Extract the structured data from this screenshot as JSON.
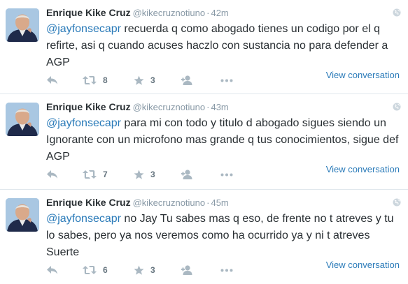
{
  "colors": {
    "link": "#2b7bb9",
    "muted": "#8899a6",
    "text": "#292f33",
    "icon": "#aab8c2"
  },
  "tweets": [
    {
      "author_name": "Enrique Kike Cruz",
      "handle": "@kikecruznotiuno",
      "separator": "·",
      "time": "42m",
      "mention": "@jayfonsecapr",
      "body": " recuerda q como abogado tienes un codigo por el q refirte, asi q cuando acuses haczlo con sustancia no para defender a AGP",
      "view_conversation": "View conversation",
      "retweet_count": "8",
      "favorite_count": "3"
    },
    {
      "author_name": "Enrique Kike Cruz",
      "handle": "@kikecruznotiuno",
      "separator": "·",
      "time": "43m",
      "mention": "@jayfonsecapr",
      "body": " para mi con todo y titulo d abogado sigues siendo un Ignorante con un microfono mas grande q tus conocimientos, sigue def AGP",
      "view_conversation": "View conversation",
      "retweet_count": "7",
      "favorite_count": "3"
    },
    {
      "author_name": "Enrique Kike Cruz",
      "handle": "@kikecruznotiuno",
      "separator": "·",
      "time": "45m",
      "mention": "@jayfonsecapr",
      "body": " no Jay Tu sabes mas q eso, de frente no t atreves y tu lo sabes, pero ya nos veremos como ha ocurrido ya y ni t atreves Suerte",
      "view_conversation": "View conversation",
      "retweet_count": "6",
      "favorite_count": "3"
    }
  ],
  "icons": {
    "reply": "reply-icon",
    "retweet": "retweet-icon",
    "favorite": "star-icon",
    "follow": "follow-icon",
    "more": "more-icon",
    "globe": "globe-icon"
  }
}
